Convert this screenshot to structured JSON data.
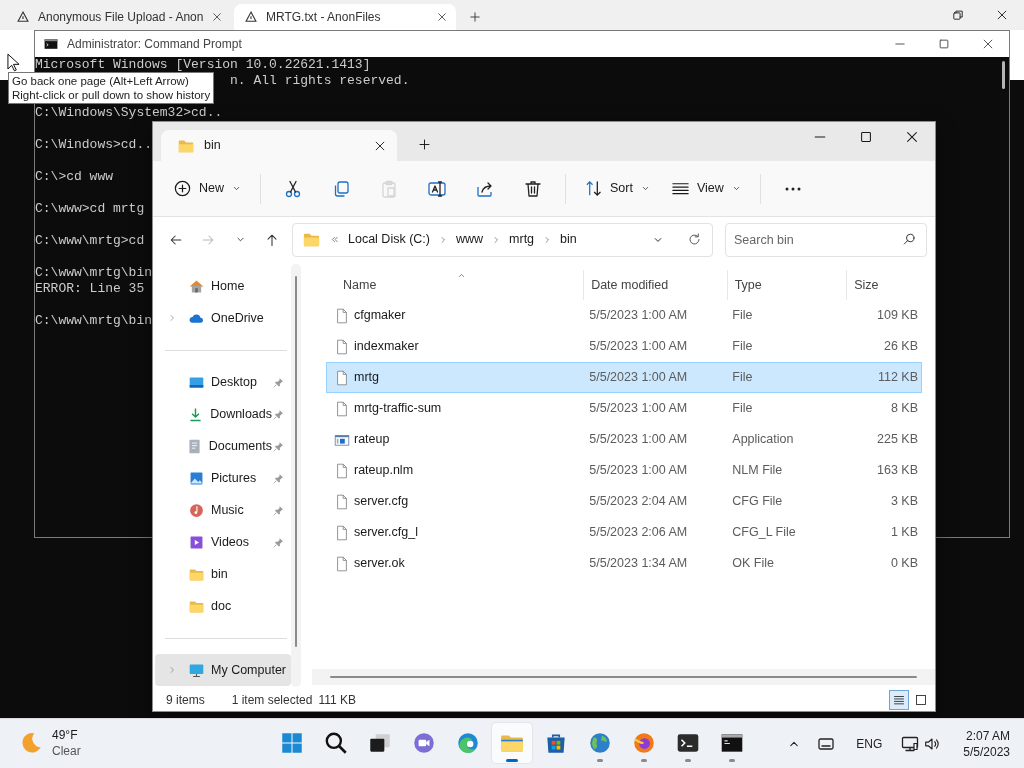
{
  "browser": {
    "tabs": [
      {
        "title": "Anonymous File Upload - Anon",
        "selected": false
      },
      {
        "title": "MRTG.txt - AnonFiles",
        "selected": true
      }
    ]
  },
  "tooltip": [
    "Go back one page (Alt+Left Arrow)",
    "Right-click or pull down to show history"
  ],
  "console": {
    "title": "Administrator: Command Prompt",
    "lines": [
      {
        "kind": "text",
        "text": "Microsoft Windows [Version 10.0.22621.1413]"
      },
      {
        "kind": "overlapped",
        "text": "n. All rights reserved."
      },
      {
        "kind": "blank"
      },
      {
        "kind": "text",
        "text": "C:\\Windows\\System32>cd.."
      },
      {
        "kind": "blank"
      },
      {
        "kind": "text",
        "text": "C:\\Windows>cd.."
      },
      {
        "kind": "blank"
      },
      {
        "kind": "text",
        "text": "C:\\>cd www"
      },
      {
        "kind": "blank"
      },
      {
        "kind": "text",
        "text": "C:\\www>cd mrtg"
      },
      {
        "kind": "blank"
      },
      {
        "kind": "text",
        "text": "C:\\www\\mrtg>cd"
      },
      {
        "kind": "blank"
      },
      {
        "kind": "text",
        "text": "C:\\www\\mrtg\\bin"
      },
      {
        "kind": "text",
        "text": "ERROR: Line 35"
      },
      {
        "kind": "blank"
      },
      {
        "kind": "text",
        "text": "C:\\www\\mrtg\\bin"
      }
    ]
  },
  "explorer": {
    "tab_title": "bin",
    "toolbar": [
      [
        {
          "kind": "new",
          "label": "New",
          "disabled": false
        }
      ],
      [
        {
          "kind": "cut",
          "disabled": false
        },
        {
          "kind": "copy",
          "disabled": false
        },
        {
          "kind": "paste",
          "disabled": true
        },
        {
          "kind": "rename",
          "disabled": false
        },
        {
          "kind": "share",
          "disabled": false
        },
        {
          "kind": "delete",
          "disabled": false
        }
      ],
      [
        {
          "kind": "sort",
          "label": "Sort",
          "disabled": false
        },
        {
          "kind": "view",
          "label": "View",
          "disabled": false
        }
      ],
      [
        {
          "kind": "more",
          "disabled": false
        }
      ]
    ],
    "nav": [
      {
        "kind": "back",
        "disabled": false
      },
      {
        "kind": "forward",
        "disabled": true
      },
      {
        "kind": "recent",
        "disabled": false
      },
      {
        "kind": "up",
        "disabled": false
      }
    ],
    "address": [
      "Local Disk (C:)",
      "www",
      "mrtg",
      "bin"
    ],
    "search": {
      "placeholder": "Search bin"
    },
    "sidebar": [
      {
        "items": [
          {
            "label": "Home",
            "kind": "home",
            "expandable": false,
            "pinned": false,
            "selected": false
          },
          {
            "label": "OneDrive",
            "kind": "cloud",
            "expandable": true,
            "pinned": false,
            "selected": false
          }
        ]
      },
      {
        "items": [
          {
            "label": "Desktop",
            "kind": "desktop",
            "expandable": false,
            "pinned": true,
            "selected": false
          },
          {
            "label": "Downloads",
            "kind": "downloads",
            "expandable": false,
            "pinned": true,
            "selected": false
          },
          {
            "label": "Documents",
            "kind": "documents",
            "expandable": false,
            "pinned": true,
            "selected": false
          },
          {
            "label": "Pictures",
            "kind": "pictures",
            "expandable": false,
            "pinned": true,
            "selected": false
          },
          {
            "label": "Music",
            "kind": "music",
            "expandable": false,
            "pinned": true,
            "selected": false
          },
          {
            "label": "Videos",
            "kind": "videos",
            "expandable": false,
            "pinned": true,
            "selected": false
          },
          {
            "label": "bin",
            "kind": "folder",
            "expandable": false,
            "pinned": false,
            "selected": false
          },
          {
            "label": "doc",
            "kind": "folder",
            "expandable": false,
            "pinned": false,
            "selected": false
          }
        ]
      },
      {
        "items": [
          {
            "label": "My Computer",
            "kind": "computer",
            "expandable": true,
            "pinned": false,
            "selected": true
          }
        ]
      }
    ],
    "columns": [
      {
        "label": "Name",
        "sorted": true
      },
      {
        "label": "Date modified",
        "sorted": false
      },
      {
        "label": "Type",
        "sorted": false
      },
      {
        "label": "Size",
        "sorted": false
      }
    ],
    "rows": [
      {
        "kind": "file",
        "name": "cfgmaker",
        "date": "5/5/2023 1:00 AM",
        "type": "File",
        "size": "109 KB",
        "selected": false
      },
      {
        "kind": "file",
        "name": "indexmaker",
        "date": "5/5/2023 1:00 AM",
        "type": "File",
        "size": "26 KB",
        "selected": false
      },
      {
        "kind": "file",
        "name": "mrtg",
        "date": "5/5/2023 1:00 AM",
        "type": "File",
        "size": "112 KB",
        "selected": true
      },
      {
        "kind": "file",
        "name": "mrtg-traffic-sum",
        "date": "5/5/2023 1:00 AM",
        "type": "File",
        "size": "8 KB",
        "selected": false
      },
      {
        "kind": "application",
        "name": "rateup",
        "date": "5/5/2023 1:00 AM",
        "type": "Application",
        "size": "225 KB",
        "selected": false
      },
      {
        "kind": "file",
        "name": "rateup.nlm",
        "date": "5/5/2023 1:00 AM",
        "type": "NLM File",
        "size": "163 KB",
        "selected": false
      },
      {
        "kind": "file",
        "name": "server.cfg",
        "date": "5/5/2023 2:04 AM",
        "type": "CFG File",
        "size": "3 KB",
        "selected": false
      },
      {
        "kind": "file",
        "name": "server.cfg_l",
        "date": "5/5/2023 2:06 AM",
        "type": "CFG_L File",
        "size": "1 KB",
        "selected": false
      },
      {
        "kind": "file",
        "name": "server.ok",
        "date": "5/5/2023 1:34 AM",
        "type": "OK File",
        "size": "0 KB",
        "selected": false
      }
    ],
    "status": {
      "count": "9 items",
      "selection": "1 item selected",
      "size": "111 KB"
    },
    "views": [
      {
        "kind": "details",
        "selected": true
      },
      {
        "kind": "tiles",
        "selected": false
      }
    ]
  },
  "taskbar": {
    "weather": {
      "temperature": "49°F",
      "condition": "Clear"
    },
    "apps": [
      {
        "kind": "start",
        "running": false,
        "active": false
      },
      {
        "kind": "search",
        "running": false,
        "active": false
      },
      {
        "kind": "taskview",
        "running": false,
        "active": false
      },
      {
        "kind": "chat",
        "running": false,
        "active": false
      },
      {
        "kind": "edge",
        "running": false,
        "active": false
      },
      {
        "kind": "explorer",
        "running": true,
        "active": true
      },
      {
        "kind": "store",
        "running": false,
        "active": false
      },
      {
        "kind": "globe",
        "running": true,
        "active": false
      },
      {
        "kind": "firefox",
        "running": true,
        "active": false
      },
      {
        "kind": "terminal",
        "running": true,
        "active": false
      },
      {
        "kind": "cmd",
        "running": true,
        "active": false
      }
    ],
    "language": "ENG",
    "time": "2:07 AM",
    "date": "5/5/2023"
  }
}
